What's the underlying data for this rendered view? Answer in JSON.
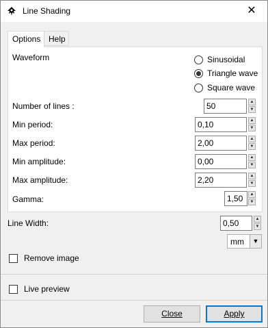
{
  "window": {
    "title": "Line Shading",
    "app_icon": "inkscape-icon",
    "close_icon": "close-icon"
  },
  "tabs": [
    {
      "label": "Options",
      "active": true
    },
    {
      "label": "Help",
      "active": false
    }
  ],
  "waveform": {
    "label": "Waveform",
    "options": [
      {
        "label": "Sinusoidal",
        "checked": false
      },
      {
        "label": "Triangle wave",
        "checked": true
      },
      {
        "label": "Square wave",
        "checked": false
      }
    ]
  },
  "fields": [
    {
      "label": "Number of lines :",
      "value": "50"
    },
    {
      "label": "Min period:",
      "value": "0,10"
    },
    {
      "label": "Max period:",
      "value": "2,00"
    },
    {
      "label": "Min amplitude:",
      "value": "0,00"
    },
    {
      "label": "Max amplitude:",
      "value": "2,20"
    },
    {
      "label": "Gamma:",
      "value": "1,50"
    }
  ],
  "line_width": {
    "label": "Line Width:",
    "value": "0,50",
    "unit": "mm"
  },
  "remove_image": {
    "label": "Remove image",
    "checked": false
  },
  "live_preview": {
    "label": "Live preview",
    "checked": false
  },
  "buttons": {
    "close": "Close",
    "apply": "Apply"
  }
}
